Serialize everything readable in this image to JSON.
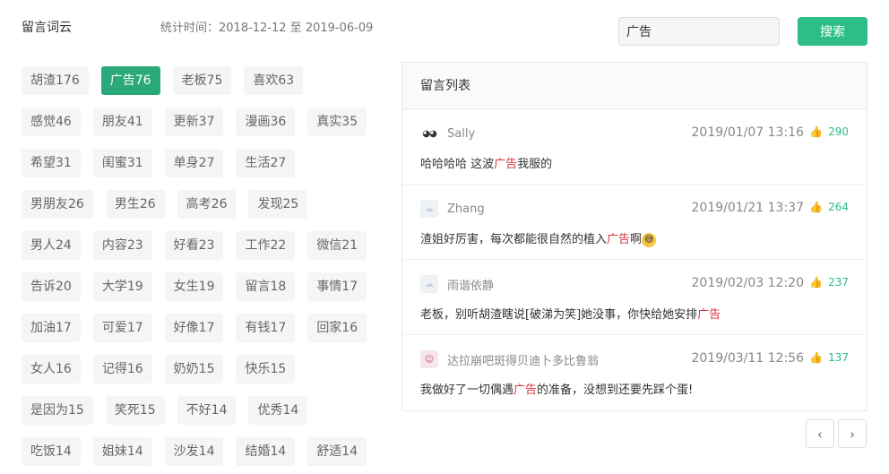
{
  "header": {
    "title": "留言词云",
    "stat_time": "统计时间：2018-12-12 至 2019-06-09"
  },
  "search": {
    "value": "广告",
    "button_label": "搜索"
  },
  "tags": [
    [
      "胡渣176",
      "广告76",
      "老板75",
      "喜欢63"
    ],
    [
      "感觉46",
      "朋友41",
      "更新37",
      "漫画36",
      "真实35"
    ],
    [
      "希望31",
      "闺蜜31",
      "单身27",
      "生活27"
    ],
    [
      "男朋友26",
      "男生26",
      "高考26",
      "发现25"
    ],
    [
      "男人24",
      "内容23",
      "好看23",
      "工作22",
      "微信21"
    ],
    [
      "告诉20",
      "大学19",
      "女生19",
      "留言18",
      "事情17"
    ],
    [
      "加油17",
      "可爱17",
      "好像17",
      "有钱17",
      "回家16"
    ],
    [
      "女人16",
      "记得16",
      "奶奶15",
      "快乐15"
    ],
    [
      "是因为15",
      "笑死15",
      "不好14",
      "优秀14"
    ],
    [
      "吃饭14",
      "姐妹14",
      "沙发14",
      "结婚14",
      "舒适14"
    ]
  ],
  "active_tag": "广告76",
  "panel": {
    "title": "留言列表",
    "comments": [
      {
        "avatar": "eyes-avatar",
        "name": "Sally",
        "time": "2019/01/07 13:16",
        "likes": "290",
        "pre": "哈哈哈哈 这波",
        "kw": "广告",
        "post": "我服的",
        "emoji": ""
      },
      {
        "avatar": "cloud-avatar",
        "name": "Zhang",
        "time": "2019/01/21 13:37",
        "likes": "264",
        "pre": "渣姐好厉害，每次都能很自然的植入",
        "kw": "广告",
        "post": "啊",
        "emoji": "😅"
      },
      {
        "avatar": "cloud-avatar",
        "name": "雨谐依静",
        "time": "2019/02/03 12:20",
        "likes": "237",
        "pre": "老板，别听胡渣瞎说[破涕为笑]她没事，你快给她安排",
        "kw": "广告",
        "post": "",
        "emoji": ""
      },
      {
        "avatar": "pink-avatar",
        "name": "达拉崩吧斑得贝迪卜多比鲁翁",
        "time": "2019/03/11 12:56",
        "likes": "137",
        "pre": "我做好了一切偶遇",
        "kw": "广告",
        "post": "的准备，没想到还要先踩个蛋!",
        "emoji": ""
      }
    ]
  },
  "pager": {
    "prev": "‹",
    "next": "›"
  },
  "colors": {
    "accent": "#2dbd88",
    "active_tag": "#2aa87a",
    "keyword": "#d9363e"
  },
  "icons": {
    "like": "thumbs-up-icon"
  }
}
